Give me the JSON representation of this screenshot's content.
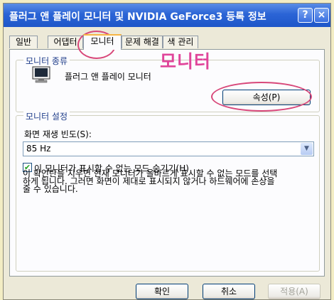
{
  "window": {
    "title": "플러그 앤 플레이 모니터 및 NVIDIA GeForce3 등록 정보",
    "help_label": "?",
    "close_label": "×"
  },
  "tabs": [
    {
      "label": "일반"
    },
    {
      "label": "어댑터"
    },
    {
      "label": "모니터"
    },
    {
      "label": "문제 해결"
    },
    {
      "label": "색 관리"
    }
  ],
  "annotation": {
    "text": "모니터"
  },
  "monitor_type": {
    "legend": "모니터 종류",
    "name": "플러그 앤 플레이 모니터",
    "properties_button": "속성(P)"
  },
  "monitor_settings": {
    "legend": "모니터 설정",
    "refresh_label": "화면 재생 빈도(S):",
    "refresh_value": "85 Hz",
    "hide_modes_checkbox": "이 모니터가 표시할 수 없는 모드 숨기기(H)",
    "hide_modes_checked": true,
    "warning_lines": [
      "이 확인란을 지우면 현재 모니터가 올바르게 표시할 수 없는 모드를 선택",
      "하게 됩니다. 그러면 화면이 제대로 표시되지 않거나 하드웨어에 손상을",
      "줄 수 있습니다."
    ]
  },
  "footer": {
    "ok": "확인",
    "cancel": "취소",
    "apply": "적용(A)"
  },
  "colors": {
    "annotation": "#e0459a",
    "titlebar": "#2b64d6",
    "dialog_bg": "#ece9d8"
  }
}
